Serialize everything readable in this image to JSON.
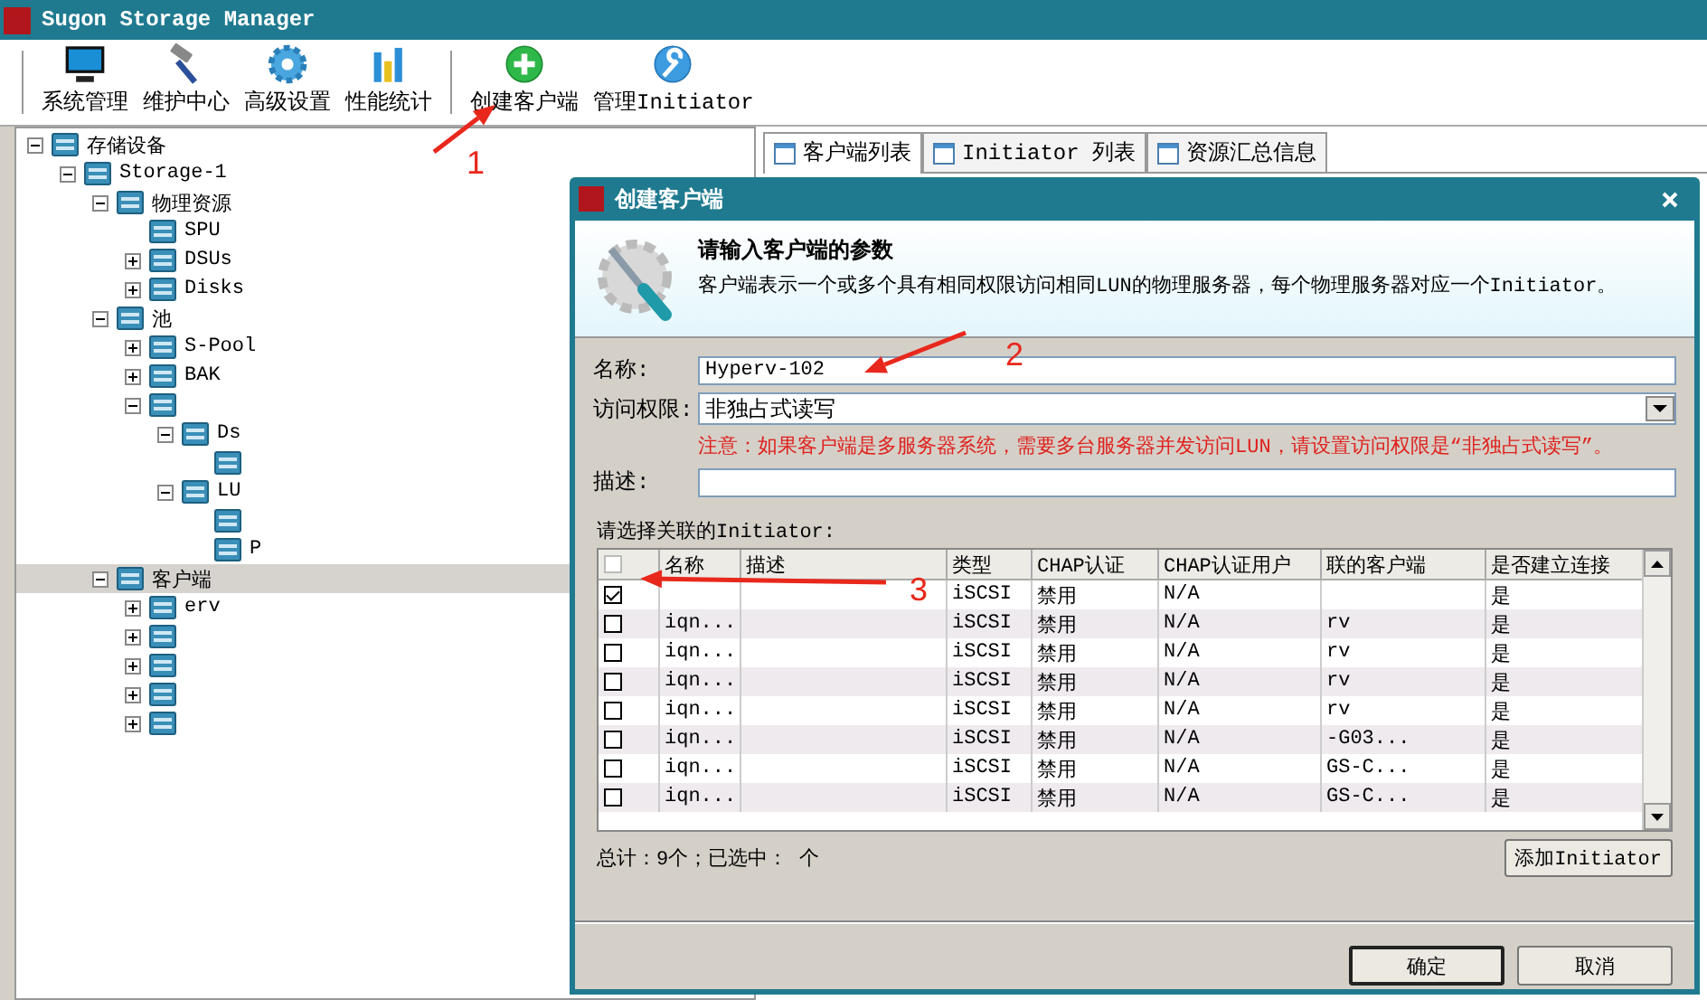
{
  "window": {
    "title": "Sugon Storage Manager"
  },
  "toolbar": {
    "groups": [
      [
        {
          "label": "系统管理",
          "kind": "monitor"
        },
        {
          "label": "维护中心",
          "kind": "hammer"
        },
        {
          "label": "高级设置",
          "kind": "gear"
        },
        {
          "label": "性能统计",
          "kind": "bars"
        }
      ],
      [
        {
          "label": "创建客户端",
          "kind": "plus"
        },
        {
          "label": "管理Initiator",
          "kind": "wrench"
        }
      ]
    ]
  },
  "tree": [
    {
      "label": "存储设备",
      "expanded": true,
      "selected": false,
      "children": [
        {
          "label": "Storage-1",
          "expanded": true,
          "selected": false,
          "children": [
            {
              "label": "物理资源",
              "expanded": true,
              "selected": false,
              "children": [
                {
                  "label": "SPU",
                  "selected": false
                },
                {
                  "label": "DSUs",
                  "expanded": false,
                  "selected": false
                },
                {
                  "label": "Disks",
                  "expanded": false,
                  "selected": false
                }
              ]
            },
            {
              "label": "池",
              "expanded": true,
              "selected": false,
              "children": [
                {
                  "label": "S-Pool",
                  "expanded": false,
                  "selected": false
                },
                {
                  "label": "BAK",
                  "expanded": false,
                  "selected": false
                },
                {
                  "expanded": true,
                  "selected": false,
                  "children": [
                    {
                      "label": "Ds",
                      "expanded": true,
                      "selected": false,
                      "children": [
                        {
                          "selected": false
                        }
                      ]
                    },
                    {
                      "label": "LU",
                      "expanded": true,
                      "selected": false,
                      "children": [
                        {
                          "selected": false
                        },
                        {
                          "label": "P",
                          "selected": false
                        }
                      ]
                    }
                  ]
                }
              ]
            },
            {
              "label": "客户端",
              "expanded": true,
              "selected": true,
              "children": [
                {
                  "label": "erv",
                  "expanded": false,
                  "selected": false
                },
                {
                  "expanded": false,
                  "selected": false
                },
                {
                  "expanded": false,
                  "selected": false
                },
                {
                  "expanded": false,
                  "selected": false
                },
                {
                  "expanded": false,
                  "selected": false
                }
              ]
            }
          ]
        }
      ]
    }
  ],
  "tabs": [
    {
      "label": "客户端列表",
      "selected": true
    },
    {
      "label": "Initiator 列表",
      "selected": false
    },
    {
      "label": "资源汇总信息",
      "selected": false
    }
  ],
  "dialog": {
    "title": "创建客户端",
    "heading": "请输入客户端的参数",
    "description": "客户端表示一个或多个具有相同权限访问相同LUN的物理服务器，每个物理服务器对应一个Initiator。",
    "fields": [
      {
        "kind": "text",
        "label": "名称:",
        "value": "Hyperv-102"
      },
      {
        "kind": "select",
        "label": "访问权限:",
        "value": "非独占式读写"
      },
      {
        "kind": "warning",
        "text": "注意：如果客户端是多服务器系统，需要多台服务器并发访问LUN，请设置访问权限是“非独占式读写”。"
      },
      {
        "kind": "text",
        "label": "描述:"
      }
    ],
    "initiator_label": "请选择关联的Initiator:",
    "table": {
      "select_all": {
        "checked": false
      },
      "columns": [
        "名称",
        "描述",
        "类型",
        "CHAP认证",
        "CHAP认证用户",
        "联的客户端",
        "是否建立连接"
      ],
      "rows": [
        {
          "checked": true,
          "type": "iSCSI",
          "chap": "禁用",
          "chap_user": "N/A",
          "connected": "是"
        },
        {
          "checked": false,
          "name": "iqn...",
          "type": "iSCSI",
          "chap": "禁用",
          "chap_user": "N/A",
          "client": "rv",
          "connected": "是"
        },
        {
          "checked": false,
          "name": "iqn...",
          "type": "iSCSI",
          "chap": "禁用",
          "chap_user": "N/A",
          "client": "rv",
          "connected": "是"
        },
        {
          "checked": false,
          "name": "iqn...",
          "type": "iSCSI",
          "chap": "禁用",
          "chap_user": "N/A",
          "client": "rv",
          "connected": "是"
        },
        {
          "checked": false,
          "name": "iqn...",
          "type": "iSCSI",
          "chap": "禁用",
          "chap_user": "N/A",
          "client": "rv",
          "connected": "是"
        },
        {
          "checked": false,
          "name": "iqn...",
          "type": "iSCSI",
          "chap": "禁用",
          "chap_user": "N/A",
          "client": "-G03...",
          "connected": "是"
        },
        {
          "checked": false,
          "name": "iqn...",
          "type": "iSCSI",
          "chap": "禁用",
          "chap_user": "N/A",
          "client": "GS-C...",
          "connected": "是"
        },
        {
          "checked": false,
          "name": "iqn...",
          "type": "iSCSI",
          "chap": "禁用",
          "chap_user": "N/A",
          "client": "GS-C...",
          "connected": "是"
        }
      ]
    },
    "summary": "总计：9个；已选中： 个",
    "add_button": "添加Initiator",
    "buttons": [
      {
        "label": "确定",
        "default": true
      },
      {
        "label": "取消",
        "default": false
      }
    ]
  },
  "annotations": [
    {
      "text": "1"
    },
    {
      "text": "2"
    },
    {
      "text": "3"
    }
  ]
}
